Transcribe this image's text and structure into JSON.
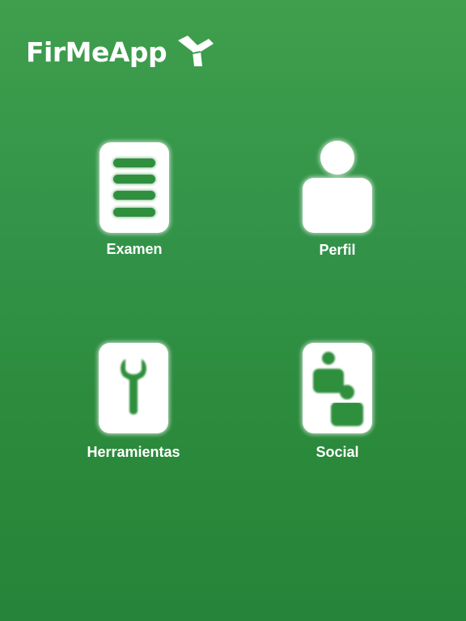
{
  "app": {
    "logo_text": "FirMeApp",
    "logo_icon": "y-bird-logo-icon"
  },
  "menu": {
    "items": [
      {
        "id": "examen",
        "label": "Examen",
        "icon": "document-lines-icon"
      },
      {
        "id": "perfil",
        "label": "Perfil",
        "icon": "person-icon"
      },
      {
        "id": "herramientas",
        "label": "Herramientas",
        "icon": "wrench-icon"
      },
      {
        "id": "social",
        "label": "Social",
        "icon": "people-icon"
      }
    ]
  },
  "colors": {
    "background_top": "#3f9f4c",
    "background_bottom": "#26843a",
    "icon_fill": "#ffffff",
    "icon_detail": "#2f8f3e"
  }
}
